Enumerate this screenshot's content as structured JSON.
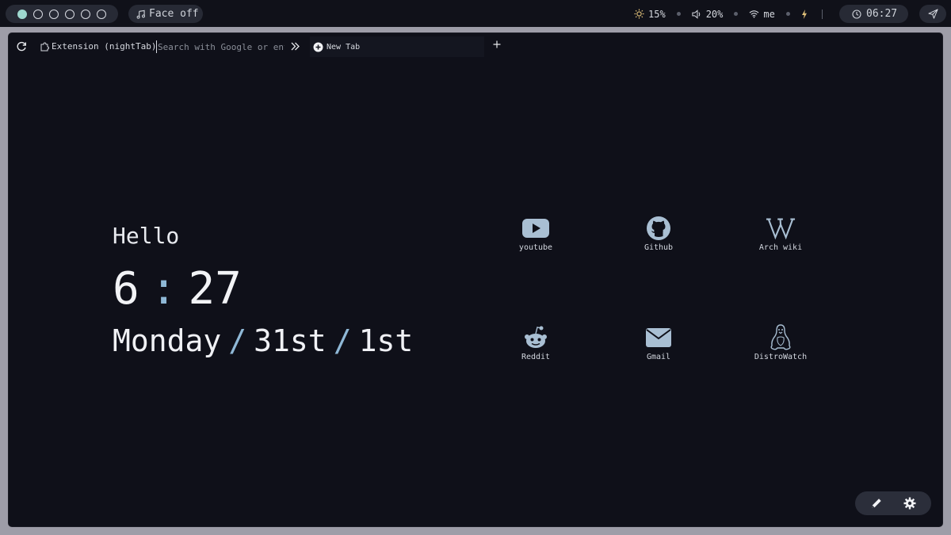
{
  "topbar": {
    "workspaces": [
      {
        "active": true
      },
      {
        "active": false
      },
      {
        "active": false
      },
      {
        "active": false
      },
      {
        "active": false
      },
      {
        "active": false
      }
    ],
    "music": {
      "icon": "music-note-icon",
      "title": "Face off"
    },
    "brightness": {
      "icon": "sun-icon",
      "value": "15%"
    },
    "volume": {
      "icon": "speaker-icon",
      "value": "20%"
    },
    "network": {
      "icon": "wifi-icon",
      "value": "me"
    },
    "power": {
      "icon": "lightning-icon"
    },
    "clock": {
      "icon": "clock-icon",
      "value": "06:27"
    },
    "send": {
      "icon": "send-icon"
    }
  },
  "browser": {
    "extension_label": "Extension (nightTab)",
    "url_placeholder": "Search with Google or enter address",
    "tab_title": "New Tab"
  },
  "header": {
    "greeting": "Hello",
    "clock": {
      "hours": "6",
      "separator": ":",
      "minutes": "27"
    },
    "date": {
      "day": "Monday",
      "separator": "/",
      "date": "31st",
      "month": "1st"
    }
  },
  "bookmarks": [
    {
      "label": "youtube",
      "icon": "youtube-icon"
    },
    {
      "label": "Github",
      "icon": "github-icon"
    },
    {
      "label": "Arch wiki",
      "icon": "wikipedia-icon"
    },
    {
      "label": "Reddit",
      "icon": "reddit-icon"
    },
    {
      "label": "Gmail",
      "icon": "mail-icon"
    },
    {
      "label": "DistroWatch",
      "icon": "linux-penguin-icon"
    }
  ],
  "colors": {
    "accent": "#9ed8cf",
    "icon": "#a9bfd3",
    "background": "#0f1019"
  }
}
